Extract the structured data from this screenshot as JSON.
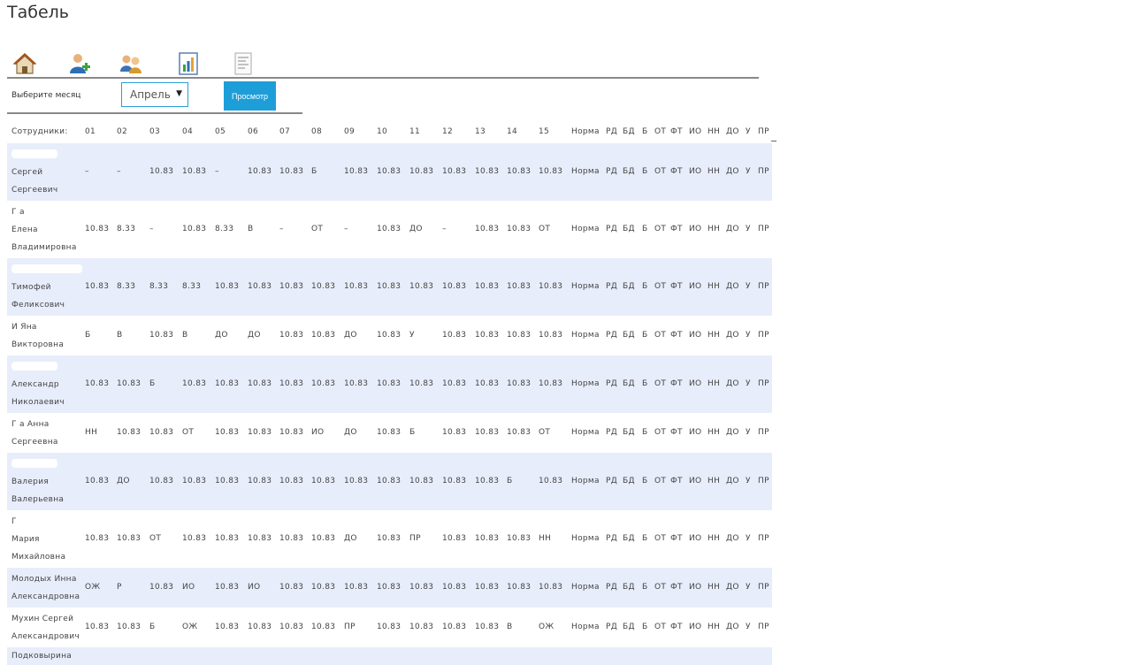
{
  "page_title": "Табель",
  "toolbar": {
    "icons": [
      "home-icon",
      "add-user-icon",
      "users-icon",
      "report-icon",
      "document-icon"
    ]
  },
  "filter": {
    "month_label": "Выберите месяц",
    "month_value": "Апрель",
    "view_button": "Просмотр"
  },
  "table": {
    "columns": [
      "Сотрудники:",
      "01",
      "02",
      "03",
      "04",
      "05",
      "06",
      "07",
      "08",
      "09",
      "10",
      "11",
      "12",
      "13",
      "14",
      "15",
      "Норма",
      "РД",
      "БД",
      "Б",
      "ОТ",
      "ФТ",
      "ИО",
      "НН",
      "ДО",
      "У",
      "ПР"
    ],
    "rows": [
      {
        "name_lines": [
          "",
          "Сергей",
          "Сергеевич"
        ],
        "cells": [
          "–",
          "–",
          "10.83",
          "10.83",
          "–",
          "10.83",
          "10.83",
          "Б",
          "10.83",
          "10.83",
          "10.83",
          "10.83",
          "10.83",
          "10.83",
          "10.83",
          "Норма",
          "РД",
          "БД",
          "Б",
          "ОТ",
          "ФТ",
          "ИО",
          "НН",
          "ДО",
          "У",
          "ПР"
        ]
      },
      {
        "name_lines": [
          "Г        а",
          "Елена",
          "Владимировна"
        ],
        "cells": [
          "10.83",
          "8.33",
          "–",
          "10.83",
          "8.33",
          "В",
          "–",
          "ОТ",
          "–",
          "10.83",
          "ДО",
          "–",
          "10.83",
          "10.83",
          "ОТ",
          "Норма",
          "РД",
          "БД",
          "Б",
          "ОТ",
          "ФТ",
          "ИО",
          "НН",
          "ДО",
          "У",
          "ПР"
        ]
      },
      {
        "name_lines": [
          "",
          "Тимофей",
          "Феликсович"
        ],
        "cells": [
          "10.83",
          "8.33",
          "8.33",
          "8.33",
          "10.83",
          "10.83",
          "10.83",
          "10.83",
          "10.83",
          "10.83",
          "10.83",
          "10.83",
          "10.83",
          "10.83",
          "10.83",
          "Норма",
          "РД",
          "БД",
          "Б",
          "ОТ",
          "ФТ",
          "ИО",
          "НН",
          "ДО",
          "У",
          "ПР"
        ]
      },
      {
        "name_lines": [
          "И     Яна",
          "Викторовна"
        ],
        "cells": [
          "Б",
          "В",
          "10.83",
          "В",
          "ДО",
          "ДО",
          "10.83",
          "10.83",
          "ДО",
          "10.83",
          "У",
          "10.83",
          "10.83",
          "10.83",
          "10.83",
          "Норма",
          "РД",
          "БД",
          "Б",
          "ОТ",
          "ФТ",
          "ИО",
          "НН",
          "ДО",
          "У",
          "ПР"
        ]
      },
      {
        "name_lines": [
          "",
          "Александр",
          "Николаевич"
        ],
        "cells": [
          "10.83",
          "10.83",
          "Б",
          "10.83",
          "10.83",
          "10.83",
          "10.83",
          "10.83",
          "10.83",
          "10.83",
          "10.83",
          "10.83",
          "10.83",
          "10.83",
          "10.83",
          "Норма",
          "РД",
          "БД",
          "Б",
          "ОТ",
          "ФТ",
          "ИО",
          "НН",
          "ДО",
          "У",
          "ПР"
        ]
      },
      {
        "name_lines": [
          "Г       а Анна",
          "Сергеевна"
        ],
        "cells": [
          "НН",
          "10.83",
          "10.83",
          "ОТ",
          "10.83",
          "10.83",
          "10.83",
          "ИО",
          "ДО",
          "10.83",
          "Б",
          "10.83",
          "10.83",
          "10.83",
          "ОТ",
          "Норма",
          "РД",
          "БД",
          "Б",
          "ОТ",
          "ФТ",
          "ИО",
          "НН",
          "ДО",
          "У",
          "ПР"
        ]
      },
      {
        "name_lines": [
          "",
          "Валерия",
          "Валерьевна"
        ],
        "cells": [
          "10.83",
          "ДО",
          "10.83",
          "10.83",
          "10.83",
          "10.83",
          "10.83",
          "10.83",
          "10.83",
          "10.83",
          "10.83",
          "10.83",
          "10.83",
          "Б",
          "10.83",
          "Норма",
          "РД",
          "БД",
          "Б",
          "ОТ",
          "ФТ",
          "ИО",
          "НН",
          "ДО",
          "У",
          "ПР"
        ]
      },
      {
        "name_lines": [
          "Г",
          "Мария",
          "Михайловна"
        ],
        "cells": [
          "10.83",
          "10.83",
          "ОТ",
          "10.83",
          "10.83",
          "10.83",
          "10.83",
          "10.83",
          "ДО",
          "10.83",
          "ПР",
          "10.83",
          "10.83",
          "10.83",
          "НН",
          "Норма",
          "РД",
          "БД",
          "Б",
          "ОТ",
          "ФТ",
          "ИО",
          "НН",
          "ДО",
          "У",
          "ПР"
        ]
      },
      {
        "name_lines": [
          "Молодых Инна",
          "Александровна"
        ],
        "cells": [
          "ОЖ",
          "Р",
          "10.83",
          "ИО",
          "10.83",
          "ИО",
          "10.83",
          "10.83",
          "10.83",
          "10.83",
          "10.83",
          "10.83",
          "10.83",
          "10.83",
          "10.83",
          "Норма",
          "РД",
          "БД",
          "Б",
          "ОТ",
          "ФТ",
          "ИО",
          "НН",
          "ДО",
          "У",
          "ПР"
        ]
      },
      {
        "name_lines": [
          "Мухин Сергей",
          "Александрович"
        ],
        "cells": [
          "10.83",
          "10.83",
          "Б",
          "ОЖ",
          "10.83",
          "10.83",
          "10.83",
          "10.83",
          "ПР",
          "10.83",
          "10.83",
          "10.83",
          "10.83",
          "В",
          "ОЖ",
          "Норма",
          "РД",
          "БД",
          "Б",
          "ОТ",
          "ФТ",
          "ИО",
          "НН",
          "ДО",
          "У",
          "ПР"
        ]
      },
      {
        "name_lines": [
          "Подковырина"
        ],
        "cells": []
      }
    ]
  }
}
